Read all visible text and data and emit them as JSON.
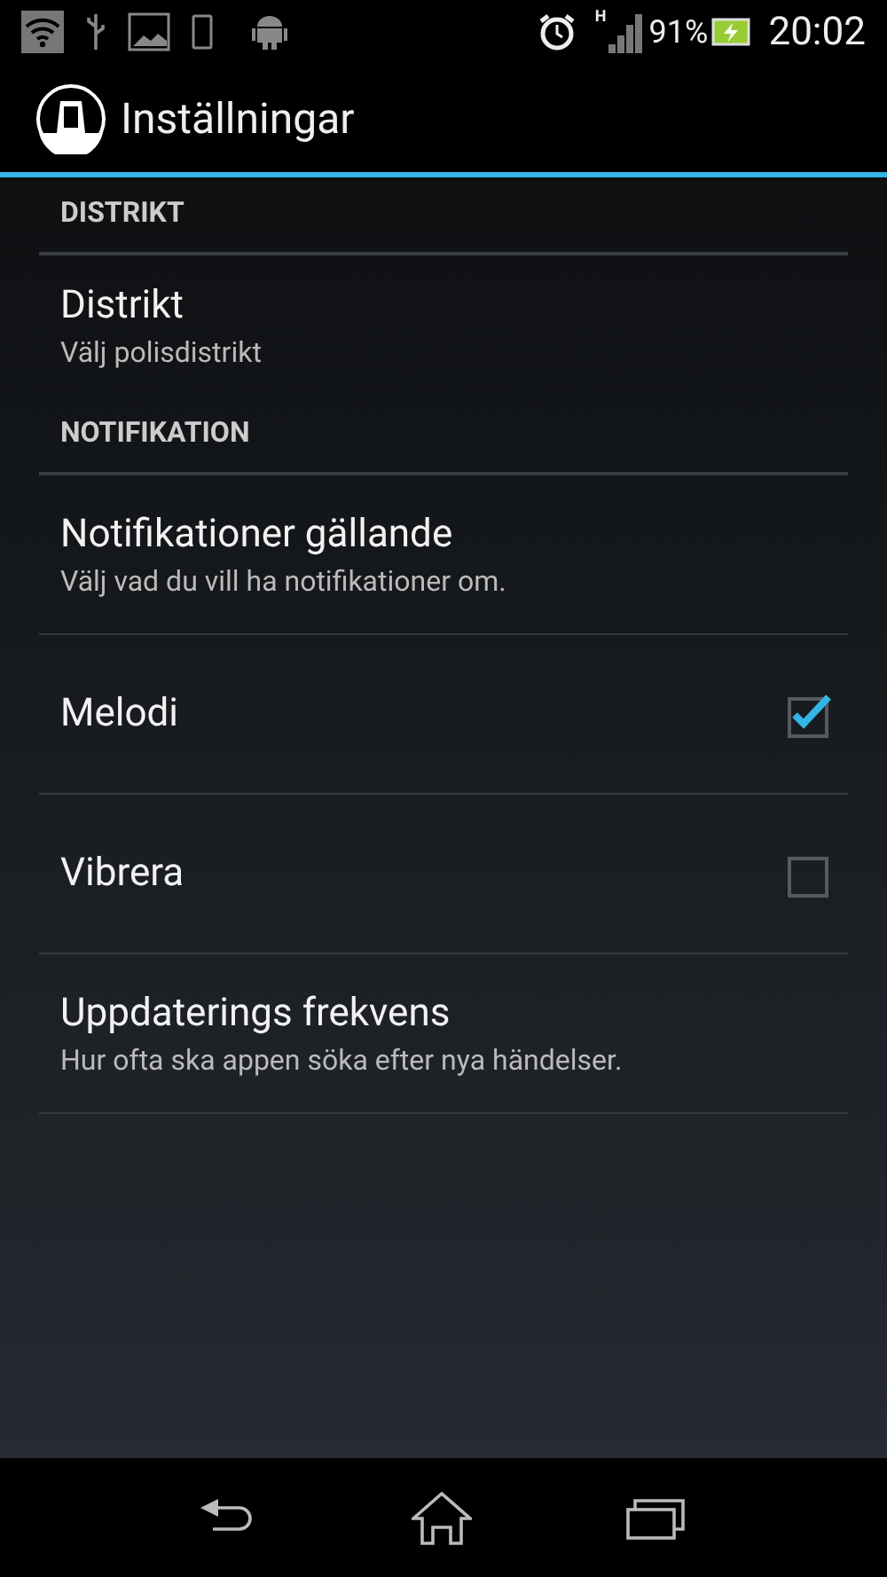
{
  "status_bar": {
    "network_type": "H",
    "battery": "91%",
    "time": "20:02"
  },
  "action_bar": {
    "title": "Inställningar"
  },
  "sections": [
    {
      "header": "DISTRIKT",
      "items": [
        {
          "kind": "text",
          "title": "Distrikt",
          "summary": "Välj polisdistrikt"
        }
      ]
    },
    {
      "header": "NOTIFIKATION",
      "items": [
        {
          "kind": "text",
          "title": "Notifikationer gällande",
          "summary": "Välj vad du vill ha notifikationer om."
        },
        {
          "kind": "checkbox",
          "title": "Melodi",
          "checked": true
        },
        {
          "kind": "checkbox",
          "title": "Vibrera",
          "checked": false
        },
        {
          "kind": "text",
          "title": "Uppdaterings frekvens",
          "summary": "Hur ofta ska appen söka efter nya händelser."
        }
      ]
    }
  ]
}
